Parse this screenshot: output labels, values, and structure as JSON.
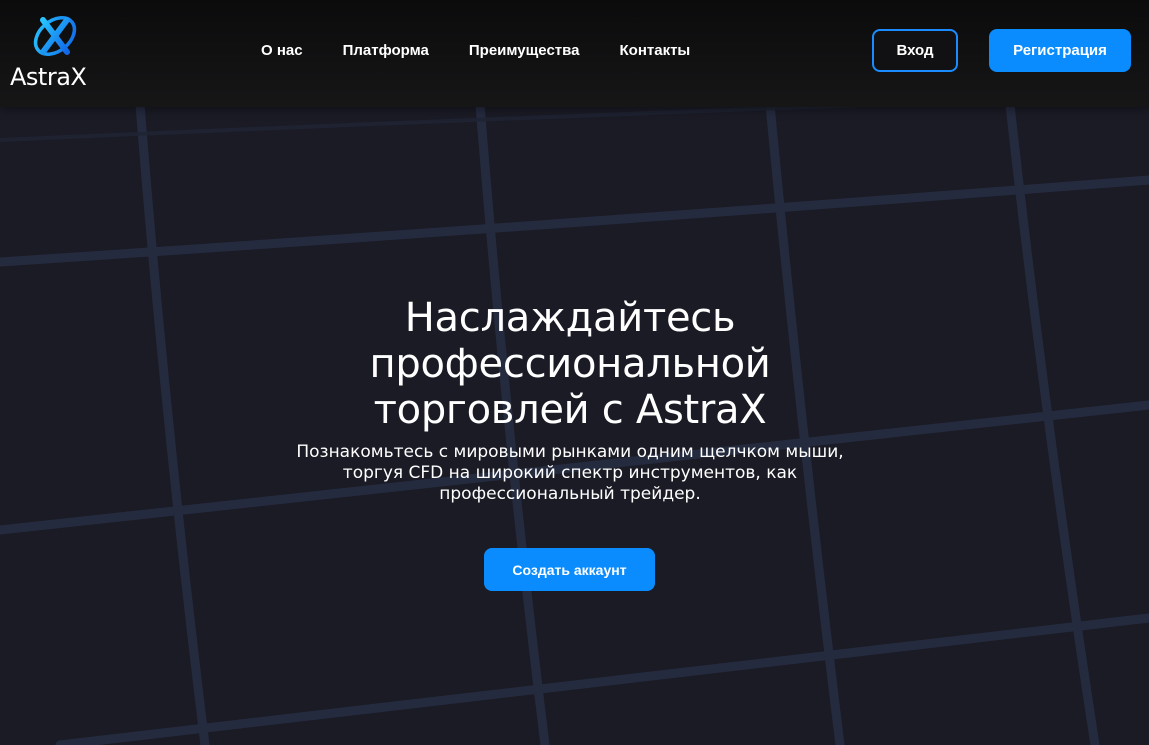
{
  "brand": {
    "name": "AstraX",
    "logo_icon": "orbit-x-logo-icon",
    "accent_color": "#0a8cff"
  },
  "nav": {
    "items": [
      {
        "label": "О нас"
      },
      {
        "label": "Платформа"
      },
      {
        "label": "Преимущества"
      },
      {
        "label": "Контакты"
      }
    ]
  },
  "header_actions": {
    "login_label": "Вход",
    "register_label": "Регистрация"
  },
  "hero": {
    "title": "Наслаждайтесь профессиональной торговлей с AstraX",
    "subtitle": "Познакомьтесь с мировыми рынками одним щелчком мыши, торгуя CFD на широкий спектр инструментов, как профессиональный трейдер.",
    "cta_label": "Создать аккаунт"
  },
  "colors": {
    "background": "#1b1b26",
    "header": "#111112",
    "grid_lines": "#262c3f"
  }
}
